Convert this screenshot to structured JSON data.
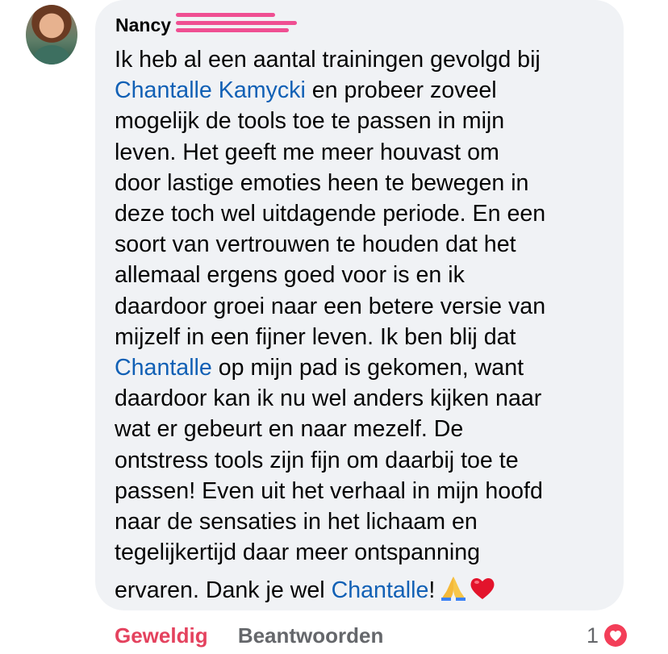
{
  "comment": {
    "author": "Nancy",
    "lines": [
      {
        "segments": [
          {
            "text": "Ik heb al een aantal trainingen gevolgd bij",
            "link": false
          }
        ]
      },
      {
        "segments": [
          {
            "text": "Chantalle Kamycki",
            "link": true
          },
          {
            "text": " en probeer zoveel",
            "link": false
          }
        ]
      },
      {
        "segments": [
          {
            "text": "mogelijk de tools toe te passen in mijn",
            "link": false
          }
        ]
      },
      {
        "segments": [
          {
            "text": "leven. Het geeft me meer houvast om",
            "link": false
          }
        ]
      },
      {
        "segments": [
          {
            "text": "door lastige emoties heen te bewegen in",
            "link": false
          }
        ]
      },
      {
        "segments": [
          {
            "text": "deze toch wel uitdagende periode. En een",
            "link": false
          }
        ]
      },
      {
        "segments": [
          {
            "text": "soort van vertrouwen te houden dat het",
            "link": false
          }
        ]
      },
      {
        "segments": [
          {
            "text": "allemaal ergens goed voor is en ik",
            "link": false
          }
        ]
      },
      {
        "segments": [
          {
            "text": "daardoor groei naar een betere versie van",
            "link": false
          }
        ]
      },
      {
        "segments": [
          {
            "text": "mijzelf in een fijner leven. Ik ben blij dat",
            "link": false
          }
        ]
      },
      {
        "segments": [
          {
            "text": "Chantalle",
            "link": true
          },
          {
            "text": " op mijn pad is gekomen, want",
            "link": false
          }
        ]
      },
      {
        "segments": [
          {
            "text": "daardoor kan ik nu wel anders kijken naar",
            "link": false
          }
        ]
      },
      {
        "segments": [
          {
            "text": "wat er gebeurt en naar mezelf. De",
            "link": false
          }
        ]
      },
      {
        "segments": [
          {
            "text": "ontstress tools zijn fijn om daarbij toe te",
            "link": false
          }
        ]
      },
      {
        "segments": [
          {
            "text": "passen! Even uit het verhaal in mijn hoofd",
            "link": false
          }
        ]
      },
      {
        "segments": [
          {
            "text": "naar de sensaties in het lichaam en",
            "link": false
          }
        ]
      },
      {
        "segments": [
          {
            "text": "tegelijkertijd daar meer ontspanning",
            "link": false
          }
        ]
      },
      {
        "segments": [
          {
            "text": "ervaren. Dank je wel ",
            "link": false
          },
          {
            "text": "Chantalle",
            "link": true
          },
          {
            "text": "!",
            "link": false
          }
        ]
      }
    ],
    "emojis": [
      "folded-hands-icon",
      "red-heart-icon"
    ]
  },
  "actions": {
    "like_label": "Geweldig",
    "reply_label": "Beantwoorden"
  },
  "reactions": {
    "count": "1",
    "icon": "heart-reaction-icon"
  },
  "colors": {
    "bubble": "#f0f2f5",
    "mention": "#1160b5",
    "like_active": "#e4425e",
    "muted": "#65676b",
    "redaction": "#ef4f92"
  }
}
